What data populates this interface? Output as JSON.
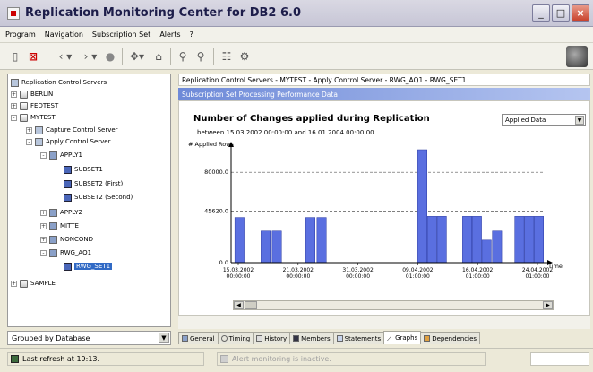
{
  "window": {
    "title": "Replication Monitoring Center for DB2 6.0"
  },
  "menu": [
    "Program",
    "Navigation",
    "Subscription Set",
    "Alerts",
    "?"
  ],
  "toolbar": {
    "icons": [
      "page-icon",
      "delete-icon",
      "back-icon",
      "forward-icon",
      "stop-icon",
      "network-icon",
      "folder-icon",
      "find-icon",
      "find-next-icon",
      "tree-icon",
      "gear-icon"
    ]
  },
  "tree": {
    "root": "Replication Control Servers",
    "items": [
      {
        "label": "BERLIN",
        "expander": "+"
      },
      {
        "label": "FEDTEST",
        "expander": "+"
      },
      {
        "label": "MYTEST",
        "expander": "-"
      },
      {
        "label": "Capture Control Server",
        "expander": "+"
      },
      {
        "label": "Apply Control Server",
        "expander": "-"
      },
      {
        "label": "APPLY1",
        "expander": "-"
      },
      {
        "label": "SUBSET1",
        "expander": ""
      },
      {
        "label": "SUBSET2 (First)",
        "expander": ""
      },
      {
        "label": "SUBSET2 (Second)",
        "expander": ""
      },
      {
        "label": "APPLY2",
        "expander": "+"
      },
      {
        "label": "MITTE",
        "expander": "+"
      },
      {
        "label": "NONCOND",
        "expander": "+"
      },
      {
        "label": "RWG_AQ1",
        "expander": "-"
      },
      {
        "label": "RWG_SET1",
        "expander": ""
      },
      {
        "label": "SAMPLE",
        "expander": "+"
      }
    ],
    "selected": "RWG_SET1"
  },
  "group_select": {
    "value": "Grouped by Database"
  },
  "breadcrumb": "Replication Control Servers - MYTEST - Apply Control Server - RWG_AQ1 - RWG_SET1",
  "section_header": "Subscription Set Processing Performance Data",
  "chart_selector": {
    "value": "Applied Data"
  },
  "chart_data": {
    "type": "bar",
    "title": "Number of Changes applied during Replication",
    "subtitle": "between 15.03.2002 00:00:00 and 16.01.2004 00:00:00",
    "ylabel": "# Applied Rows",
    "xlabel": "Time",
    "ylim": [
      0,
      100000
    ],
    "y_reference_lines": [
      {
        "value": 80000,
        "label": "80000.0"
      },
      {
        "value": 45620,
        "label": "45620.0"
      }
    ],
    "y_ticks": [
      {
        "value": 0,
        "label": "0.0"
      }
    ],
    "x_tick_labels": [
      [
        "15.03.2002",
        "00:00:00"
      ],
      [
        "21.03.2002",
        "00:00:00"
      ],
      [
        "31.03.2002",
        "00:00:00"
      ],
      [
        "09.04.2002",
        "01:00:00"
      ],
      [
        "16.04.2002",
        "01:00:00"
      ],
      [
        "24.04.2002",
        "01:00:00"
      ]
    ],
    "values": [
      40000,
      28000,
      28000,
      40000,
      40000,
      100000,
      41000,
      41000,
      41000,
      41000,
      20000,
      28000,
      41000,
      41000,
      41000
    ],
    "bar_positions": [
      0.5,
      4,
      5.5,
      10,
      11.5,
      25,
      26.3,
      27.6,
      31,
      32.3,
      33.6,
      35,
      38,
      39.3,
      40.6
    ],
    "x_range": [
      0,
      42
    ],
    "bar_color": "#5a6fe0"
  },
  "tabs": [
    {
      "label": "General",
      "icon": "general-icon"
    },
    {
      "label": "Timing",
      "icon": "clock-icon"
    },
    {
      "label": "History",
      "icon": "history-icon"
    },
    {
      "label": "Members",
      "icon": "members-icon"
    },
    {
      "label": "Statements",
      "icon": "statements-icon"
    },
    {
      "label": "Graphs",
      "icon": "graph-icon",
      "active": true
    },
    {
      "label": "Dependencies",
      "icon": "dependencies-icon"
    }
  ],
  "status": {
    "left": "Last refresh at 19:13.",
    "middle": "Alert monitoring is inactive."
  }
}
